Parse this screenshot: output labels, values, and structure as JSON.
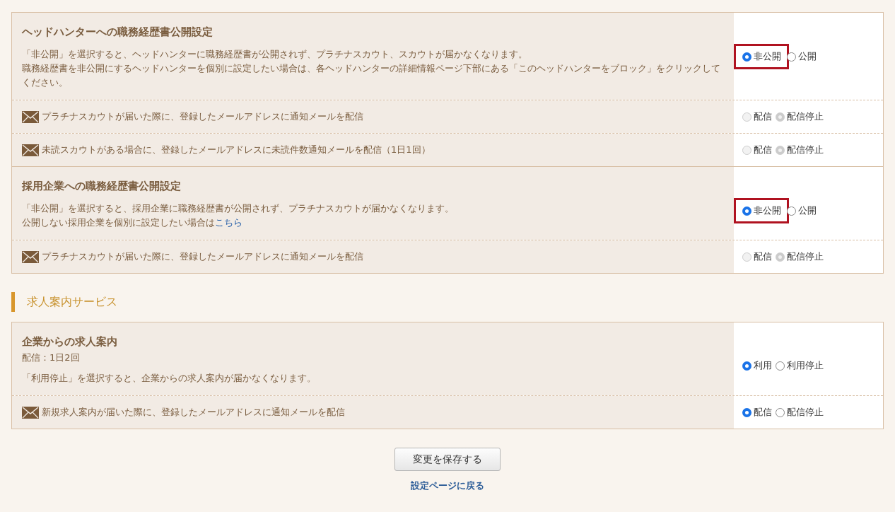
{
  "settings_table": {
    "rows": [
      {
        "kind": "setting",
        "title": "ヘッドハンターへの職務経歴書公開設定",
        "paragraphs": [
          {
            "text": "「非公開」を選択すると、ヘッドハンターに職務経歴書が公開されず、プラチナスカウト、スカウトが届かなくなります。"
          },
          {
            "text": "職務経歴書を非公開にするヘッドハンターを個別に設定したい場合は、各ヘッドハンターの詳細情報ページ下部にある「このヘッドハンターをブロック」をクリックしてください。"
          }
        ],
        "highlighted": true,
        "options": [
          {
            "label": "非公開",
            "selected": true,
            "disabled": false
          },
          {
            "label": "公開",
            "selected": false,
            "disabled": false
          }
        ]
      },
      {
        "kind": "notify",
        "text": "プラチナスカウトが届いた際に、登録したメールアドレスに通知メールを配信",
        "options": [
          {
            "label": "配信",
            "selected": false,
            "disabled": true
          },
          {
            "label": "配信停止",
            "selected": true,
            "disabled": true
          }
        ]
      },
      {
        "kind": "notify",
        "text": "未読スカウトがある場合に、登録したメールアドレスに未読件数通知メールを配信（1日1回）",
        "options": [
          {
            "label": "配信",
            "selected": false,
            "disabled": true
          },
          {
            "label": "配信停止",
            "selected": true,
            "disabled": true
          }
        ]
      },
      {
        "kind": "setting",
        "title": "採用企業への職務経歴書公開設定",
        "paragraphs": [
          {
            "text": "「非公開」を選択すると、採用企業に職務経歴書が公開されず、プラチナスカウトが届かなくなります。"
          },
          {
            "text": "公開しない採用企業を個別に設定したい場合は",
            "link": "こちら"
          }
        ],
        "highlighted": true,
        "options": [
          {
            "label": "非公開",
            "selected": true,
            "disabled": false
          },
          {
            "label": "公開",
            "selected": false,
            "disabled": false
          }
        ]
      },
      {
        "kind": "notify",
        "text": "プラチナスカウトが届いた際に、登録したメールアドレスに通知メールを配信",
        "options": [
          {
            "label": "配信",
            "selected": false,
            "disabled": true
          },
          {
            "label": "配信停止",
            "selected": true,
            "disabled": true
          }
        ]
      }
    ]
  },
  "job_section": {
    "heading": "求人案内サービス",
    "rows": [
      {
        "kind": "setting",
        "title": "企業からの求人案内",
        "meta": "配信：1日2回",
        "paragraphs": [
          {
            "text": "「利用停止」を選択すると、企業からの求人案内が届かなくなります。"
          }
        ],
        "highlighted": false,
        "options": [
          {
            "label": "利用",
            "selected": true,
            "disabled": false
          },
          {
            "label": "利用停止",
            "selected": false,
            "disabled": false
          }
        ]
      },
      {
        "kind": "notify",
        "text": "新規求人案内が届いた際に、登録したメールアドレスに通知メールを配信",
        "options": [
          {
            "label": "配信",
            "selected": true,
            "disabled": false
          },
          {
            "label": "配信停止",
            "selected": false,
            "disabled": false
          }
        ]
      }
    ]
  },
  "save_button": "変更を保存する",
  "back_link": "設定ページに戻る"
}
